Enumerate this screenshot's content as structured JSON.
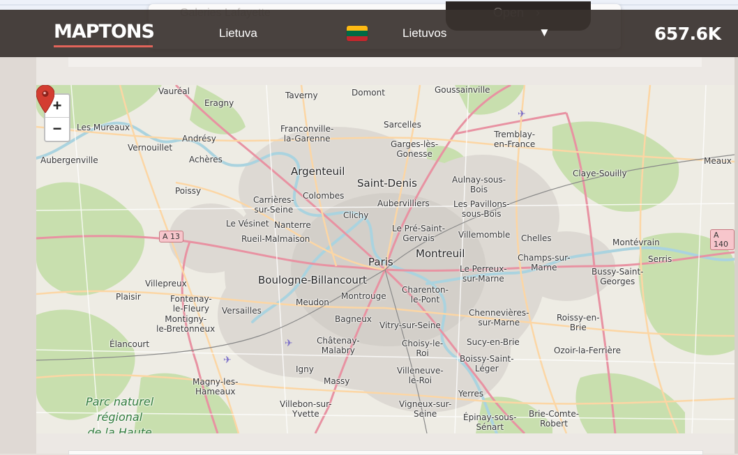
{
  "header": {
    "ghost_text": "Galeries Lafayette",
    "open_label": "Open",
    "open_chevron": "›",
    "logo": "MAPTONS",
    "country_link": "Lietuva",
    "region_link": "Lietuvos",
    "dropdown_arrow": "▼",
    "views": "657.6K"
  },
  "flag": {
    "colors": [
      "#fdb913",
      "#006a44",
      "#c1272d"
    ]
  },
  "map": {
    "zoom_in": "+",
    "zoom_out": "−",
    "labels": {
      "vaureal": "Vauréal",
      "eragny": "Eragny",
      "taverny": "Taverny",
      "domont": "Domont",
      "goussainville": "Goussainville",
      "lesmureaux": "Les Mureaux",
      "franconville": "Franconville-\nla-Garenne",
      "sarcelles": "Sarcelles",
      "tremblay": "Tremblay-\nen-France",
      "vernouillet": "Vernouillet",
      "andresy": "Andrésy",
      "garges": "Garges-lès-\nGonesse",
      "aubergenville": "Aubergenville",
      "acheres": "Achères",
      "argenteuil": "Argenteuil",
      "saintdenis": "Saint-Denis",
      "aulnay": "Aulnay-sous-\nBois",
      "claye": "Claye-Souilly",
      "meaux": "Meaux",
      "poissy": "Poissy",
      "colombes": "Colombes",
      "carrieres": "Carrières-\nsur-Seine",
      "aubervilliers": "Aubervilliers",
      "pavillons": "Les Pavillons-\nsous-Bois",
      "vesinet": "Le Vésinet",
      "nanterre": "Nanterre",
      "clichy": "Clichy",
      "preston": "Le Pré-Saint-\nGervais",
      "villemomble": "Villemomble",
      "chelles": "Chelles",
      "montevrain": "Montévrain",
      "serris": "Serris",
      "rueil": "Rueil-Malmaison",
      "paris": "Paris",
      "montreuil": "Montreuil",
      "champs": "Champs-sur-\nMarne",
      "perreux": "Le Perreux-\nsur-Marne",
      "bussy": "Bussy-Saint-\nGeorges",
      "villepreux": "Villepreux",
      "boulogne": "Boulogne-Billancourt",
      "plaisir": "Plaisir",
      "fontenay": "Fontenay-\nle-Fleury",
      "meudon": "Meudon",
      "montrouge": "Montrouge",
      "charenton": "Charenton-\nle-Pont",
      "versailles": "Versailles",
      "chennevieres": "Chennevières-\nsur-Marne",
      "roissy": "Roissy-en-\nBrie",
      "montigny": "Montigny-\nle-Bretonneux",
      "bagneux": "Bagneux",
      "vitry": "Vitry-sur-Seine",
      "elancourt": "Élancourt",
      "chatenay": "Châtenay-\nMalabry",
      "choisy": "Choisy-le-\nRoi",
      "sucy": "Sucy-en-Brie",
      "ozoir": "Ozoir-la-Ferrière",
      "boissy": "Boissy-Saint-\nLéger",
      "igny": "Igny",
      "villeneuve": "Villeneuve-\nle-Roi",
      "magny": "Magny-les-\nHameaux",
      "massy": "Massy",
      "yerres": "Yerres",
      "park": "Parc naturel\nrégional\nde la Haute",
      "villebon": "Villebon-sur-\nYvette",
      "vigneux": "Vigneux-sur-\nSeine",
      "epinay": "Épinay-sous-\nSénart",
      "briecomte": "Brie-Comte-\nRobert"
    },
    "roads": {
      "a13": "A 13",
      "a140": "A 140"
    },
    "airport_icon": "✈",
    "land_colors": {
      "forest": "#c8dfae",
      "urban": "#ddd9d3",
      "water": "#aad3df"
    }
  }
}
